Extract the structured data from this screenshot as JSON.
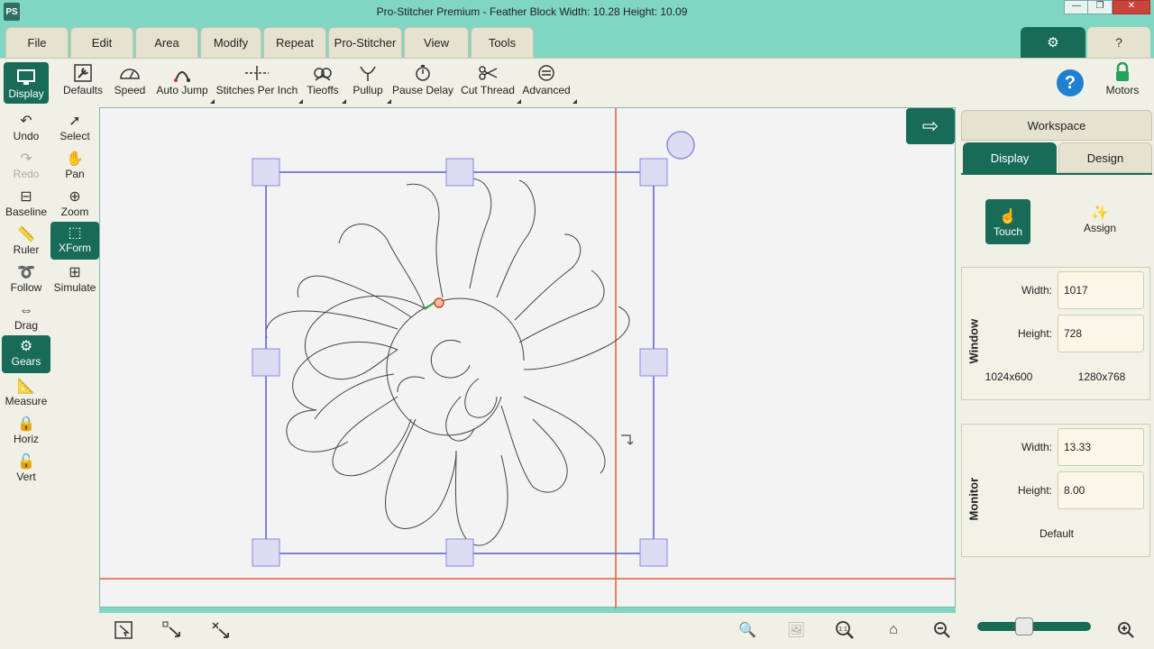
{
  "window": {
    "logo": "PS",
    "title": "Pro-Stitcher Premium   -   Feather Block   Width: 10.28    Height: 10.09",
    "minimize": "—",
    "maximize": "❐",
    "close": "✕"
  },
  "menu": {
    "tabs": [
      "File",
      "Edit",
      "Area",
      "Modify",
      "Repeat",
      "Pro-Stitcher",
      "View",
      "Tools"
    ],
    "settings_icon": "gear-icon",
    "help_icon": "question-icon"
  },
  "toolbar": {
    "display": "Display",
    "defaults": "Defaults",
    "speed": "Speed",
    "auto_jump": "Auto Jump",
    "stitches_per_inch": "Stitches Per Inch",
    "tieoffs": "Tieoffs",
    "pullup": "Pullup",
    "pause_delay": "Pause Delay",
    "cut_thread": "Cut Thread",
    "advanced": "Advanced",
    "motors": "Motors"
  },
  "left_tools": {
    "undo": "Undo",
    "select": "Select",
    "redo": "Redo",
    "pan": "Pan",
    "baseline": "Baseline",
    "zoom": "Zoom",
    "ruler": "Ruler",
    "xform": "XForm",
    "follow": "Follow",
    "simulate": "Simulate",
    "drag": "Drag",
    "gears": "Gears",
    "measure": "Measure",
    "horiz": "Horiz",
    "vert": "Vert"
  },
  "right_panel": {
    "workspace_tab": "Workspace",
    "display_tab": "Display",
    "design_tab": "Design",
    "touch": "Touch",
    "assign": "Assign",
    "window_group": {
      "title": "Window",
      "width_label": "Width:",
      "width_value": "1017",
      "height_label": "Height:",
      "height_value": "728",
      "preset_1": "1024x600",
      "preset_2": "1280x768"
    },
    "monitor_group": {
      "title": "Monitor",
      "width_label": "Width:",
      "width_value": "13.33",
      "height_label": "Height:",
      "height_value": "8.00",
      "default": "Default"
    }
  },
  "colors": {
    "accent": "#176b57",
    "title_bar": "#7fd6c2",
    "selection": "#5b5bd6",
    "guide_line": "#e0603a"
  }
}
